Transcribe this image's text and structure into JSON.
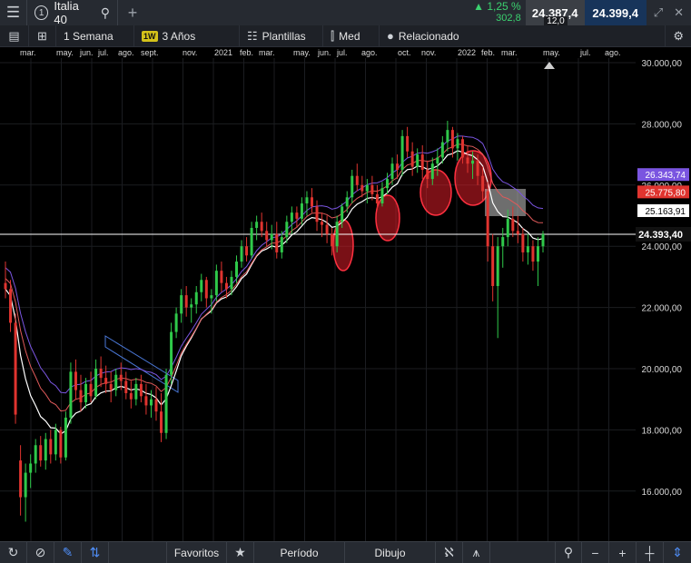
{
  "header": {
    "tab_number": "1",
    "instrument": "Italia 40",
    "change_pct": "1,25 %",
    "change_abs": "302,8",
    "bid": "24.387,4",
    "ask": "24.399,4",
    "spread": "12,0"
  },
  "toolbar": {
    "timeframe_label": "1 Semana",
    "timeframe_badge": "1W",
    "range_label": "3 Años",
    "templates_label": "Plantillas",
    "price_type_label": "Med",
    "related_label": "Relacionado"
  },
  "date_axis": [
    "mar.",
    "may.",
    "jun.",
    "jul.",
    "ago.",
    "sept.",
    "nov.",
    "2021",
    "feb.",
    "mar.",
    "may.",
    "jun.",
    "jul.",
    "ago.",
    "oct.",
    "nov.",
    "2022",
    "feb.",
    "mar.",
    "may.",
    "jul.",
    "ago."
  ],
  "bottom": {
    "favorites_label": "Favoritos",
    "period_label": "Período",
    "drawing_label": "Dibujo"
  },
  "colors": {
    "up": "#2fc94a",
    "down": "#e0342f",
    "ma_fast": "#ffffff",
    "ma_mid": "#e05a5a",
    "ma_slow": "#7a55e0",
    "accent": "#4f8df5"
  },
  "chart_data": {
    "type": "candlestick",
    "interval": "1 Semana",
    "ylim": [
      15000,
      30500
    ],
    "y_ticks": [
      "30.000,00",
      "28.000,00",
      "26.000,00",
      "24.000,00",
      "22.000,00",
      "20.000,00",
      "18.000,00",
      "16.000,00"
    ],
    "y_tick_values": [
      30000,
      28000,
      26000,
      24000,
      22000,
      20000,
      18000,
      16000
    ],
    "last_price": 24393.4,
    "last_price_label": "24.393,40",
    "ma_labels": [
      {
        "label": "26.343,74",
        "value": 26343.74,
        "color": "#7a55e0"
      },
      {
        "label": "25.775,80",
        "value": 25775.8,
        "color": "#e0342f"
      },
      {
        "label": "25.163,91",
        "value": 25163.91,
        "color": "#ffffff"
      }
    ],
    "candles": [
      {
        "o": 22800,
        "h": 23500,
        "l": 22300,
        "c": 22600
      },
      {
        "o": 22600,
        "h": 22900,
        "l": 21200,
        "c": 21500
      },
      {
        "o": 21500,
        "h": 21800,
        "l": 18200,
        "c": 18500
      },
      {
        "o": 17000,
        "h": 17500,
        "l": 15200,
        "c": 15800
      },
      {
        "o": 15800,
        "h": 16900,
        "l": 15000,
        "c": 16600
      },
      {
        "o": 16600,
        "h": 17200,
        "l": 16100,
        "c": 16900
      },
      {
        "o": 16900,
        "h": 17700,
        "l": 16600,
        "c": 17500
      },
      {
        "o": 17500,
        "h": 17800,
        "l": 16800,
        "c": 17000
      },
      {
        "o": 17000,
        "h": 17900,
        "l": 16700,
        "c": 17700
      },
      {
        "o": 17700,
        "h": 18000,
        "l": 16900,
        "c": 17200
      },
      {
        "o": 17200,
        "h": 18200,
        "l": 17000,
        "c": 18000
      },
      {
        "o": 18000,
        "h": 18100,
        "l": 16900,
        "c": 17100
      },
      {
        "o": 17100,
        "h": 18600,
        "l": 17000,
        "c": 18400
      },
      {
        "o": 18400,
        "h": 20200,
        "l": 18200,
        "c": 19900
      },
      {
        "o": 19900,
        "h": 20300,
        "l": 19000,
        "c": 19300
      },
      {
        "o": 19300,
        "h": 19800,
        "l": 18600,
        "c": 18900
      },
      {
        "o": 18900,
        "h": 19700,
        "l": 18700,
        "c": 19500
      },
      {
        "o": 19500,
        "h": 19900,
        "l": 18900,
        "c": 19100
      },
      {
        "o": 19100,
        "h": 20300,
        "l": 19000,
        "c": 20000
      },
      {
        "o": 20000,
        "h": 20400,
        "l": 19400,
        "c": 19700
      },
      {
        "o": 19700,
        "h": 20100,
        "l": 19200,
        "c": 19500
      },
      {
        "o": 19500,
        "h": 19900,
        "l": 18900,
        "c": 19300
      },
      {
        "o": 19300,
        "h": 20000,
        "l": 19100,
        "c": 19800
      },
      {
        "o": 19800,
        "h": 20200,
        "l": 19300,
        "c": 19600
      },
      {
        "o": 19600,
        "h": 19900,
        "l": 19000,
        "c": 19200
      },
      {
        "o": 19200,
        "h": 19600,
        "l": 18700,
        "c": 19000
      },
      {
        "o": 19000,
        "h": 19700,
        "l": 18800,
        "c": 19500
      },
      {
        "o": 19500,
        "h": 19800,
        "l": 18900,
        "c": 19100
      },
      {
        "o": 19100,
        "h": 19500,
        "l": 18500,
        "c": 18800
      },
      {
        "o": 18800,
        "h": 19300,
        "l": 18400,
        "c": 19000
      },
      {
        "o": 19000,
        "h": 19400,
        "l": 18300,
        "c": 18600
      },
      {
        "o": 18600,
        "h": 19200,
        "l": 17600,
        "c": 17900
      },
      {
        "o": 17900,
        "h": 20000,
        "l": 17700,
        "c": 19800
      },
      {
        "o": 19800,
        "h": 21500,
        "l": 19500,
        "c": 21200
      },
      {
        "o": 21200,
        "h": 22000,
        "l": 21000,
        "c": 21800
      },
      {
        "o": 21800,
        "h": 22600,
        "l": 21500,
        "c": 22400
      },
      {
        "o": 22400,
        "h": 22700,
        "l": 21700,
        "c": 22000
      },
      {
        "o": 22000,
        "h": 22300,
        "l": 21500,
        "c": 22100
      },
      {
        "o": 22100,
        "h": 22700,
        "l": 21800,
        "c": 22500
      },
      {
        "o": 22500,
        "h": 23100,
        "l": 22200,
        "c": 22900
      },
      {
        "o": 22900,
        "h": 23000,
        "l": 22000,
        "c": 22300
      },
      {
        "o": 22300,
        "h": 22600,
        "l": 21800,
        "c": 22400
      },
      {
        "o": 22400,
        "h": 23400,
        "l": 22200,
        "c": 23200
      },
      {
        "o": 23200,
        "h": 23500,
        "l": 22500,
        "c": 22800
      },
      {
        "o": 22800,
        "h": 23000,
        "l": 22300,
        "c": 22600
      },
      {
        "o": 22600,
        "h": 23200,
        "l": 22400,
        "c": 23000
      },
      {
        "o": 23000,
        "h": 23700,
        "l": 22800,
        "c": 23500
      },
      {
        "o": 23500,
        "h": 24200,
        "l": 23300,
        "c": 24000
      },
      {
        "o": 24000,
        "h": 24300,
        "l": 23500,
        "c": 23700
      },
      {
        "o": 23700,
        "h": 24800,
        "l": 23600,
        "c": 24600
      },
      {
        "o": 24600,
        "h": 25000,
        "l": 24200,
        "c": 24800
      },
      {
        "o": 24800,
        "h": 25100,
        "l": 24300,
        "c": 24500
      },
      {
        "o": 24500,
        "h": 24800,
        "l": 24000,
        "c": 24200
      },
      {
        "o": 24200,
        "h": 24700,
        "l": 23900,
        "c": 24400
      },
      {
        "o": 24400,
        "h": 24800,
        "l": 23600,
        "c": 23800
      },
      {
        "o": 23800,
        "h": 24500,
        "l": 23600,
        "c": 24300
      },
      {
        "o": 24300,
        "h": 25000,
        "l": 24100,
        "c": 24800
      },
      {
        "o": 24800,
        "h": 25300,
        "l": 24400,
        "c": 25100
      },
      {
        "o": 25100,
        "h": 25300,
        "l": 24600,
        "c": 24900
      },
      {
        "o": 24900,
        "h": 25600,
        "l": 24700,
        "c": 25400
      },
      {
        "o": 25400,
        "h": 25800,
        "l": 25000,
        "c": 25600
      },
      {
        "o": 25600,
        "h": 25900,
        "l": 25100,
        "c": 25300
      },
      {
        "o": 25300,
        "h": 25500,
        "l": 24500,
        "c": 24800
      },
      {
        "o": 24800,
        "h": 25100,
        "l": 24300,
        "c": 24700
      },
      {
        "o": 24700,
        "h": 25000,
        "l": 24100,
        "c": 24400
      },
      {
        "o": 24400,
        "h": 24600,
        "l": 23700,
        "c": 24000
      },
      {
        "o": 24000,
        "h": 25000,
        "l": 23800,
        "c": 24800
      },
      {
        "o": 24800,
        "h": 25400,
        "l": 24600,
        "c": 25300
      },
      {
        "o": 25300,
        "h": 25800,
        "l": 25100,
        "c": 25600
      },
      {
        "o": 25600,
        "h": 26500,
        "l": 25400,
        "c": 26300
      },
      {
        "o": 26300,
        "h": 26700,
        "l": 25800,
        "c": 26000
      },
      {
        "o": 26000,
        "h": 26300,
        "l": 25600,
        "c": 25800
      },
      {
        "o": 25800,
        "h": 26200,
        "l": 25400,
        "c": 26000
      },
      {
        "o": 26000,
        "h": 26300,
        "l": 25500,
        "c": 25700
      },
      {
        "o": 25700,
        "h": 26000,
        "l": 25200,
        "c": 25400
      },
      {
        "o": 25400,
        "h": 26100,
        "l": 25300,
        "c": 25900
      },
      {
        "o": 25900,
        "h": 26400,
        "l": 25700,
        "c": 26200
      },
      {
        "o": 26200,
        "h": 26900,
        "l": 26000,
        "c": 26700
      },
      {
        "o": 26700,
        "h": 27000,
        "l": 26200,
        "c": 26500
      },
      {
        "o": 26500,
        "h": 27800,
        "l": 26300,
        "c": 27600
      },
      {
        "o": 27600,
        "h": 27900,
        "l": 26900,
        "c": 27100
      },
      {
        "o": 27100,
        "h": 27400,
        "l": 26300,
        "c": 26600
      },
      {
        "o": 26600,
        "h": 27200,
        "l": 26400,
        "c": 27000
      },
      {
        "o": 27000,
        "h": 27300,
        "l": 26200,
        "c": 26500
      },
      {
        "o": 26500,
        "h": 26800,
        "l": 25900,
        "c": 26200
      },
      {
        "o": 26200,
        "h": 26900,
        "l": 26000,
        "c": 26700
      },
      {
        "o": 26700,
        "h": 27200,
        "l": 26300,
        "c": 26900
      },
      {
        "o": 26900,
        "h": 27600,
        "l": 26700,
        "c": 27400
      },
      {
        "o": 27400,
        "h": 28100,
        "l": 27100,
        "c": 27800
      },
      {
        "o": 27800,
        "h": 27900,
        "l": 26900,
        "c": 27200
      },
      {
        "o": 27200,
        "h": 27700,
        "l": 26800,
        "c": 27500
      },
      {
        "o": 27500,
        "h": 27600,
        "l": 26700,
        "c": 26900
      },
      {
        "o": 26900,
        "h": 27300,
        "l": 26400,
        "c": 26700
      },
      {
        "o": 26700,
        "h": 27100,
        "l": 26200,
        "c": 26800
      },
      {
        "o": 26800,
        "h": 27000,
        "l": 26000,
        "c": 26300
      },
      {
        "o": 26300,
        "h": 26600,
        "l": 25500,
        "c": 25800
      },
      {
        "o": 25800,
        "h": 26100,
        "l": 23500,
        "c": 24000
      },
      {
        "o": 24000,
        "h": 24400,
        "l": 22200,
        "c": 22700
      },
      {
        "o": 22700,
        "h": 24300,
        "l": 21000,
        "c": 24000
      },
      {
        "o": 24000,
        "h": 24600,
        "l": 23300,
        "c": 24300
      },
      {
        "o": 24300,
        "h": 25200,
        "l": 24000,
        "c": 24900
      },
      {
        "o": 24900,
        "h": 25300,
        "l": 24300,
        "c": 24500
      },
      {
        "o": 24500,
        "h": 25000,
        "l": 24100,
        "c": 24400
      },
      {
        "o": 24400,
        "h": 24600,
        "l": 23500,
        "c": 23800
      },
      {
        "o": 23800,
        "h": 24400,
        "l": 23400,
        "c": 24000
      },
      {
        "o": 24000,
        "h": 24200,
        "l": 23200,
        "c": 23500
      },
      {
        "o": 23500,
        "h": 24300,
        "l": 22700,
        "c": 24000
      },
      {
        "o": 24000,
        "h": 24500,
        "l": 23800,
        "c": 24393
      }
    ]
  }
}
